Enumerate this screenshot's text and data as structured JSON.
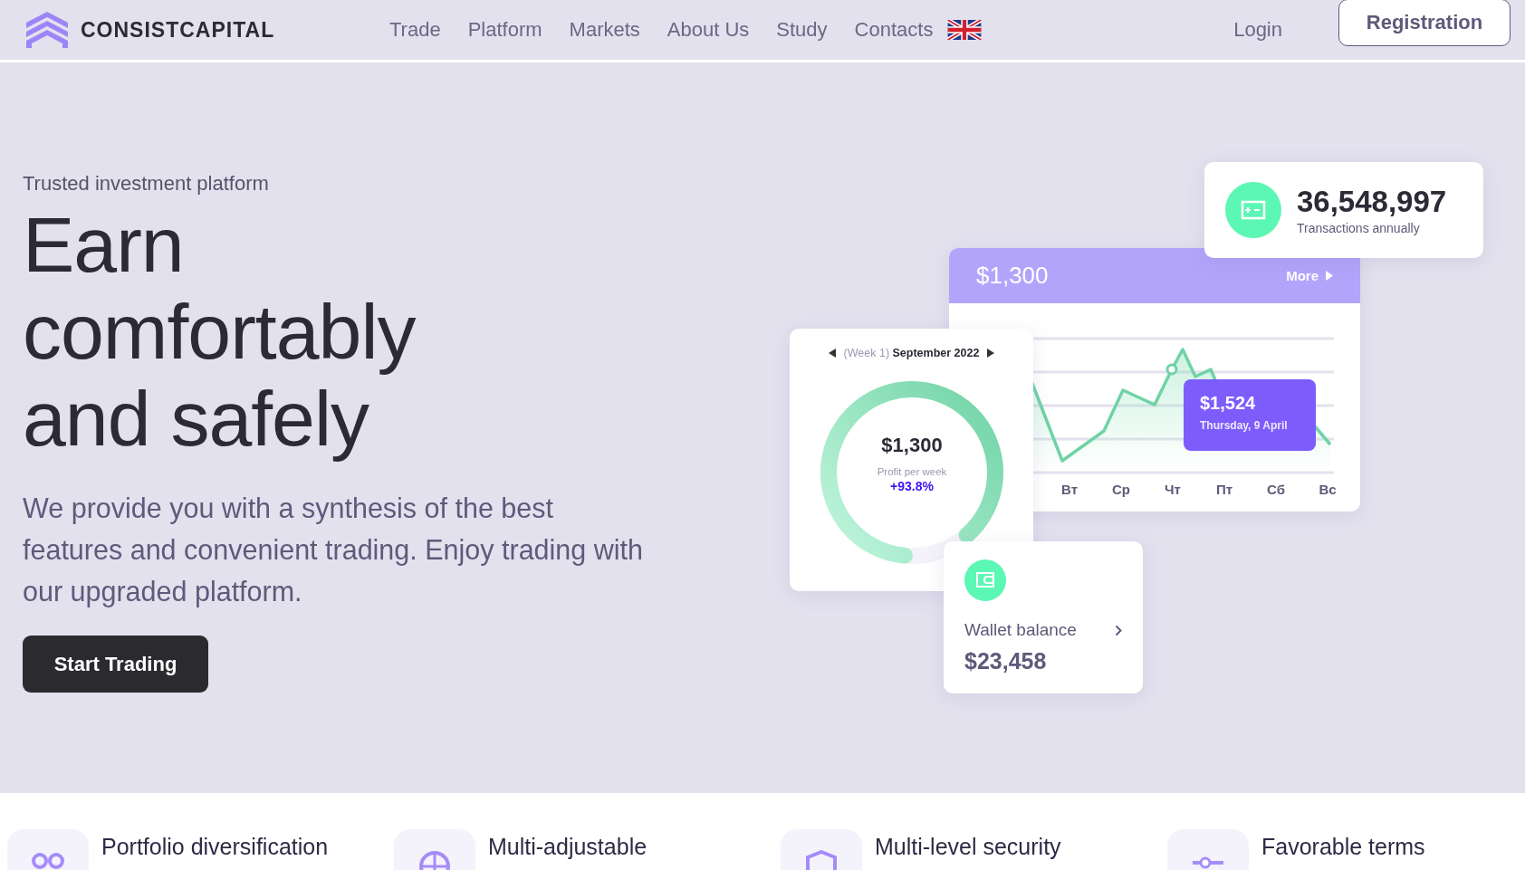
{
  "header": {
    "logo": "CONSISTCAPITAL",
    "nav": [
      {
        "label": "Trade"
      },
      {
        "label": "Platform"
      },
      {
        "label": "Markets"
      },
      {
        "label": "About Us"
      },
      {
        "label": "Study"
      },
      {
        "label": "Contacts"
      }
    ],
    "login": "Login",
    "register": "Registration"
  },
  "hero": {
    "eyebrow": "Trusted investment platform",
    "title": "Earn comfortably and safely",
    "text": "We provide you with a synthesis of the best features and convenient trading. Enjoy trading with our upgraded platform.",
    "cta": "Start Trading"
  },
  "stats": {
    "value": "36,548,997",
    "label": "Transactions annually"
  },
  "chart_card": {
    "amount": "$1,300",
    "more": "More",
    "days": [
      "Вт",
      "Ср",
      "Чт",
      "Пт",
      "Сб",
      "Вс"
    ],
    "tooltip": {
      "value": "$1,524",
      "date": "Thursday, 9 April"
    }
  },
  "week_card": {
    "week": "(Week 1)",
    "month": "September 2022",
    "amount": "$1,300",
    "label": "Profit per week",
    "change": "+93.8%",
    "level": 0.87
  },
  "wallet": {
    "label": "Wallet balance",
    "amount": "$23,458"
  },
  "features": [
    {
      "title": "Portfolio diversification"
    },
    {
      "title": "Multi-adjustable"
    },
    {
      "title": "Multi-level security"
    },
    {
      "title": "Favorable terms"
    }
  ]
}
